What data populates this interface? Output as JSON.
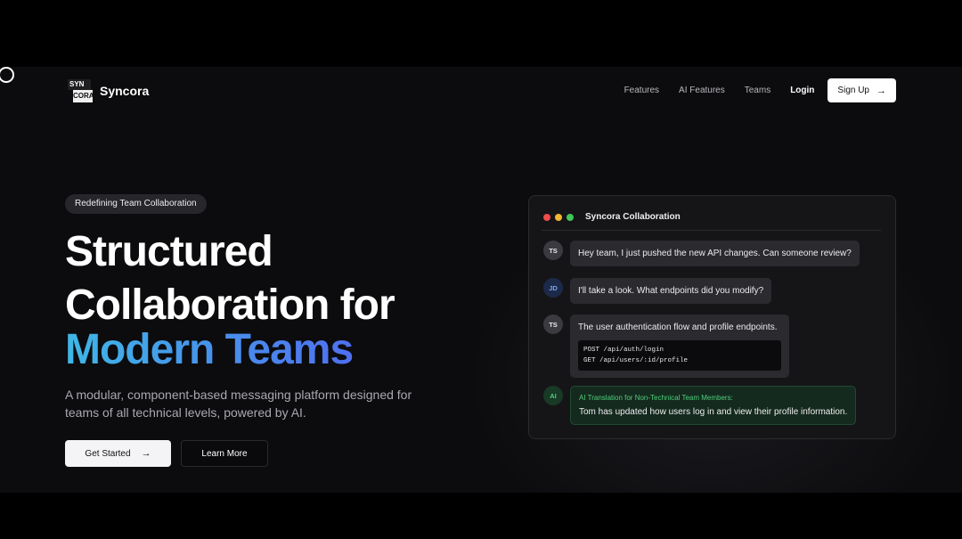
{
  "brand": {
    "logo_top": "SYN",
    "logo_bottom": "CORA",
    "name": "Syncora"
  },
  "nav": {
    "items": [
      {
        "label": "Features"
      },
      {
        "label": "AI Features"
      },
      {
        "label": "Teams"
      }
    ],
    "login": "Login",
    "signup": "Sign Up",
    "signup_icon": "arrow-right-icon"
  },
  "hero": {
    "badge": "Redefining Team Collaboration",
    "title_line1": "Structured",
    "title_line2": "Collaboration for",
    "title_line3": "Modern Teams",
    "subtitle": "A modular, component-based messaging platform designed for teams of all technical levels, powered by AI.",
    "primary_button": "Get Started",
    "secondary_button": "Learn More"
  },
  "chat": {
    "title": "Syncora Collaboration",
    "window_dots": [
      "#ef4b4b",
      "#f2b632",
      "#3ec95a"
    ],
    "messages": [
      {
        "avatar": "TS",
        "text": "Hey team, I just pushed the new API changes. Can someone review?"
      },
      {
        "avatar": "JD",
        "text": "I'll take a look. What endpoints did you modify?"
      },
      {
        "avatar": "TS",
        "text": "The user authentication flow and profile endpoints.",
        "code": [
          "POST /api/auth/login",
          "GET /api/users/:id/profile"
        ]
      },
      {
        "avatar": "AI",
        "label": "AI Translation for Non-Technical Team Members:",
        "text": "Tom has updated how users log in and view their profile information."
      }
    ]
  },
  "colors": {
    "accent_gradient_start": "#3fb7e6",
    "accent_gradient_end": "#4f6ff0",
    "ai_green": "#4fce7c"
  }
}
